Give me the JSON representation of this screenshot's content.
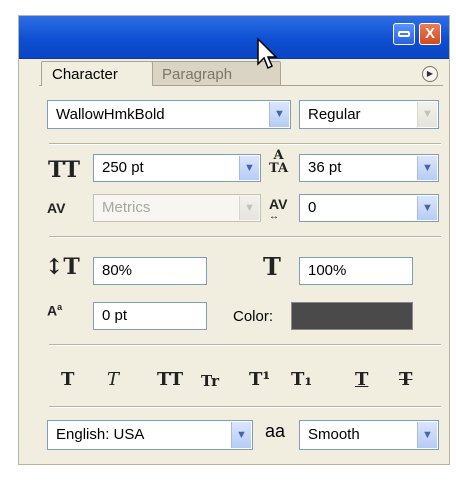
{
  "tabs": {
    "active": "Character",
    "inactive": "Paragraph"
  },
  "font": {
    "family": "WallowHmkBold",
    "style": "Regular"
  },
  "size": {
    "value": "250 pt"
  },
  "leading": {
    "value": "36 pt"
  },
  "kerning": {
    "value": "Metrics"
  },
  "tracking": {
    "value": "0"
  },
  "vertical_scale": {
    "value": "80%"
  },
  "horizontal_scale": {
    "value": "100%"
  },
  "baseline_shift": {
    "value": "0 pt"
  },
  "color": {
    "label": "Color:",
    "swatch": "#4a4a4a"
  },
  "style_buttons": [
    "T",
    "T",
    "TT",
    "Tr",
    "T¹",
    "T₁",
    "T",
    "T"
  ],
  "language": {
    "value": "English: USA"
  },
  "antialias": {
    "icon_text": "aa",
    "value": "Smooth"
  },
  "window_buttons": {
    "close": "X"
  },
  "colors": {
    "titlebar": "#0e4fd2",
    "panel": "#f1eddf",
    "dropdown_arrow": "#4764a8"
  }
}
